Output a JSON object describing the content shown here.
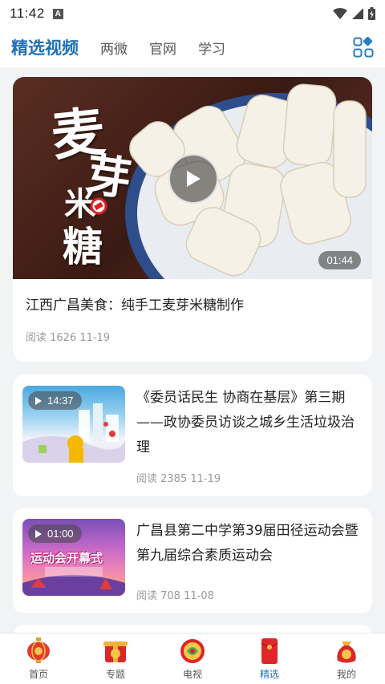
{
  "status_bar": {
    "time": "11:42",
    "notification_glyph": "A"
  },
  "top_nav": {
    "tabs": [
      {
        "label": "精选视频",
        "active": true
      },
      {
        "label": "两微",
        "active": false
      },
      {
        "label": "官网",
        "active": false
      },
      {
        "label": "学习",
        "active": false
      }
    ],
    "more_icon": "grid-icon"
  },
  "feed": {
    "featured": {
      "title": "江西广昌美食：纯手工麦芽米糖制作",
      "reads": "阅读 1626",
      "date": "11-19",
      "duration": "01:44",
      "thumb_text": [
        "麦",
        "芽",
        "米",
        "糖"
      ]
    },
    "items": [
      {
        "title": "《委员话民生 协商在基层》第三期——政协委员访谈之城乡生活垃圾治理",
        "reads": "阅读 2385",
        "date": "11-19",
        "duration": "14:37"
      },
      {
        "title": "广昌县第二中学第39届田径运动会暨第九届综合素质运动会",
        "reads": "阅读 708",
        "date": "11-08",
        "duration": "01:00",
        "thumb_text": "运动会开幕式"
      }
    ]
  },
  "bottom_tabs": [
    {
      "label": "首页",
      "icon": "lantern-icon",
      "active": false
    },
    {
      "label": "专题",
      "icon": "gift-icon",
      "active": false
    },
    {
      "label": "电视",
      "icon": "tv-icon",
      "active": false
    },
    {
      "label": "精选",
      "icon": "red-envelope-icon",
      "active": true
    },
    {
      "label": "我的",
      "icon": "lucky-bag-icon",
      "active": false
    }
  ],
  "colors": {
    "accent": "#1f6fb8",
    "background": "#f2f3f5"
  }
}
